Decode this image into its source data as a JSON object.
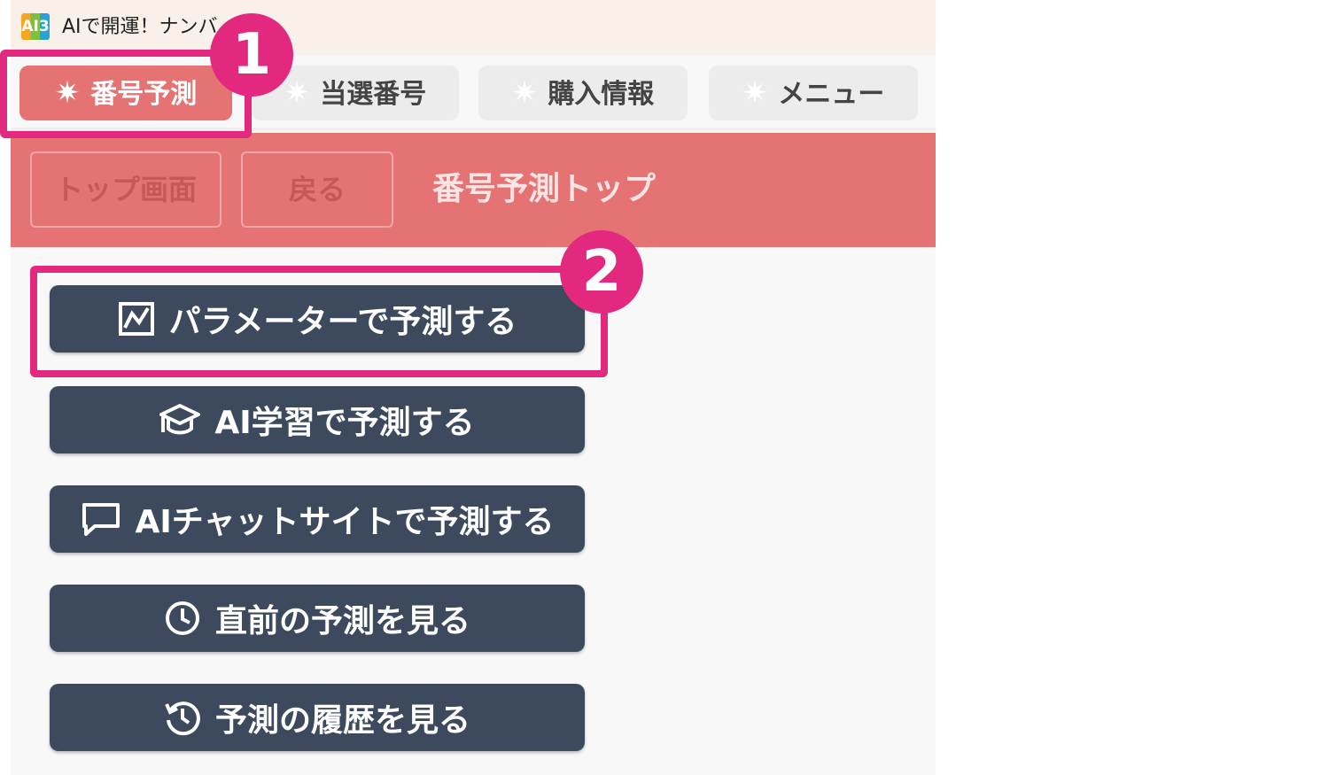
{
  "window": {
    "app_icon_text": "AI3",
    "title": "AIで開運！ナンバ"
  },
  "tabs": [
    {
      "label": "番号予測",
      "icon": "sparkle-icon",
      "active": true
    },
    {
      "label": "当選番号",
      "icon": "sparkle-icon",
      "active": false
    },
    {
      "label": "購入情報",
      "icon": "sparkle-icon",
      "active": false
    },
    {
      "label": "メニュー",
      "icon": "sparkle-icon",
      "active": false
    }
  ],
  "header": {
    "top_button": "トップ画面",
    "back_button": "戻る",
    "title": "番号予測トップ"
  },
  "actions": [
    {
      "label": "パラメーターで予測する",
      "icon": "parameter-chart-icon"
    },
    {
      "label": "AI学習で予測する",
      "icon": "graduation-cap-icon"
    },
    {
      "label": "AIチャットサイトで予測する",
      "icon": "chat-bubble-icon"
    },
    {
      "label": "直前の予測を見る",
      "icon": "clock-icon"
    },
    {
      "label": "予測の履歴を見る",
      "icon": "history-icon"
    }
  ],
  "annotations": {
    "badge_1": "1",
    "badge_2": "2"
  },
  "colors": {
    "accent": "#e57373",
    "button_bg": "#3d4a5e",
    "highlight": "#e2297f"
  }
}
